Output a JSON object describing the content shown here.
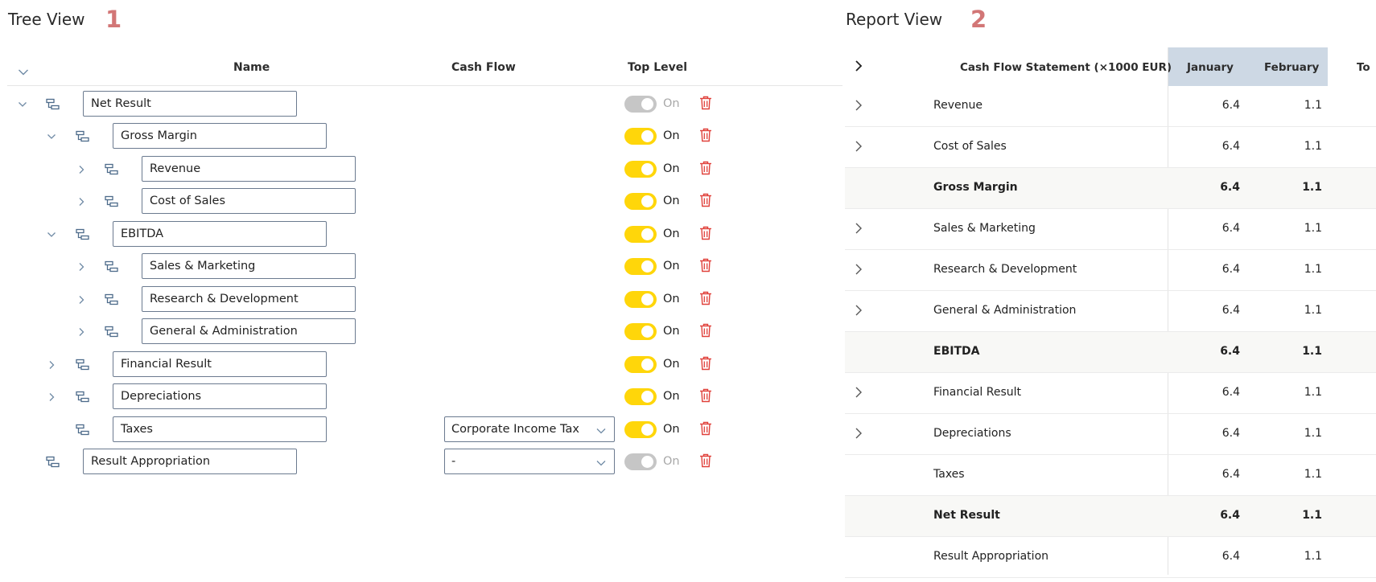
{
  "tree_view": {
    "title": "Tree View",
    "badge": "1",
    "headers": {
      "name": "Name",
      "cash_flow": "Cash Flow",
      "top_level": "Top Level"
    },
    "rows": [
      {
        "name": "Net Result",
        "depth": 0,
        "expander": "expanded",
        "cash_flow": "",
        "top_level": "On",
        "toggle_state": "disabled"
      },
      {
        "name": "Gross Margin",
        "depth": 1,
        "expander": "expanded",
        "cash_flow": "",
        "top_level": "On",
        "toggle_state": "on"
      },
      {
        "name": "Revenue",
        "depth": 2,
        "expander": "collapsed",
        "cash_flow": "",
        "top_level": "On",
        "toggle_state": "on"
      },
      {
        "name": "Cost of Sales",
        "depth": 2,
        "expander": "collapsed",
        "cash_flow": "",
        "top_level": "On",
        "toggle_state": "on"
      },
      {
        "name": "EBITDA",
        "depth": 1,
        "expander": "expanded",
        "cash_flow": "",
        "top_level": "On",
        "toggle_state": "on"
      },
      {
        "name": "Sales & Marketing",
        "depth": 2,
        "expander": "collapsed",
        "cash_flow": "",
        "top_level": "On",
        "toggle_state": "on"
      },
      {
        "name": "Research & Development",
        "depth": 2,
        "expander": "collapsed",
        "cash_flow": "",
        "top_level": "On",
        "toggle_state": "on"
      },
      {
        "name": "General & Administration",
        "depth": 2,
        "expander": "collapsed",
        "cash_flow": "",
        "top_level": "On",
        "toggle_state": "on"
      },
      {
        "name": "Financial Result",
        "depth": 1,
        "expander": "collapsed",
        "cash_flow": "",
        "top_level": "On",
        "toggle_state": "on"
      },
      {
        "name": "Depreciations",
        "depth": 1,
        "expander": "collapsed",
        "cash_flow": "",
        "top_level": "On",
        "toggle_state": "on"
      },
      {
        "name": "Taxes",
        "depth": 1,
        "expander": "none",
        "cash_flow": "Corporate Income Tax",
        "top_level": "On",
        "toggle_state": "on"
      },
      {
        "name": "Result Appropriation",
        "depth": 0,
        "expander": "none",
        "cash_flow": "-",
        "top_level": "On",
        "toggle_state": "disabled"
      }
    ]
  },
  "report_view": {
    "title": "Report View",
    "badge": "2",
    "headers": {
      "statement": "Cash Flow Statement (×1000 EUR)",
      "months": [
        "January",
        "February"
      ],
      "total_partial": "To"
    },
    "rows": [
      {
        "label": "Revenue",
        "expandable": true,
        "bold": false,
        "january": "6.4",
        "february": "1.1"
      },
      {
        "label": "Cost of Sales",
        "expandable": true,
        "bold": false,
        "january": "6.4",
        "february": "1.1"
      },
      {
        "label": "Gross Margin",
        "expandable": false,
        "bold": true,
        "january": "6.4",
        "february": "1.1"
      },
      {
        "label": "Sales & Marketing",
        "expandable": true,
        "bold": false,
        "january": "6.4",
        "february": "1.1"
      },
      {
        "label": "Research & Development",
        "expandable": true,
        "bold": false,
        "january": "6.4",
        "february": "1.1"
      },
      {
        "label": "General & Administration",
        "expandable": true,
        "bold": false,
        "january": "6.4",
        "february": "1.1"
      },
      {
        "label": "EBITDA",
        "expandable": false,
        "bold": true,
        "january": "6.4",
        "february": "1.1"
      },
      {
        "label": "Financial Result",
        "expandable": true,
        "bold": false,
        "january": "6.4",
        "february": "1.1"
      },
      {
        "label": "Depreciations",
        "expandable": true,
        "bold": false,
        "january": "6.4",
        "february": "1.1"
      },
      {
        "label": "Taxes",
        "expandable": false,
        "bold": false,
        "january": "6.4",
        "february": "1.1"
      },
      {
        "label": "Net Result",
        "expandable": false,
        "bold": true,
        "january": "6.4",
        "february": "1.1"
      },
      {
        "label": "Result Appropriation",
        "expandable": false,
        "bold": false,
        "january": "6.4",
        "february": "1.1"
      }
    ]
  },
  "colors": {
    "badge": "#d27676",
    "toggle_on": "#ffd60a",
    "toggle_disabled": "#c6c6c6",
    "delete_icon": "#e0413b",
    "report_month_header_bg": "#cdd8e4",
    "bold_row_bg": "#f8f8f6"
  },
  "icons": {
    "expand_all": "chevron-down-icon",
    "expanded": "chevron-down-icon",
    "collapsed": "chevron-right-icon",
    "node": "hierarchy-node-icon",
    "delete": "trash-icon",
    "dropdown": "caret-down-icon",
    "report_expand_all": "chevron-right-icon"
  }
}
